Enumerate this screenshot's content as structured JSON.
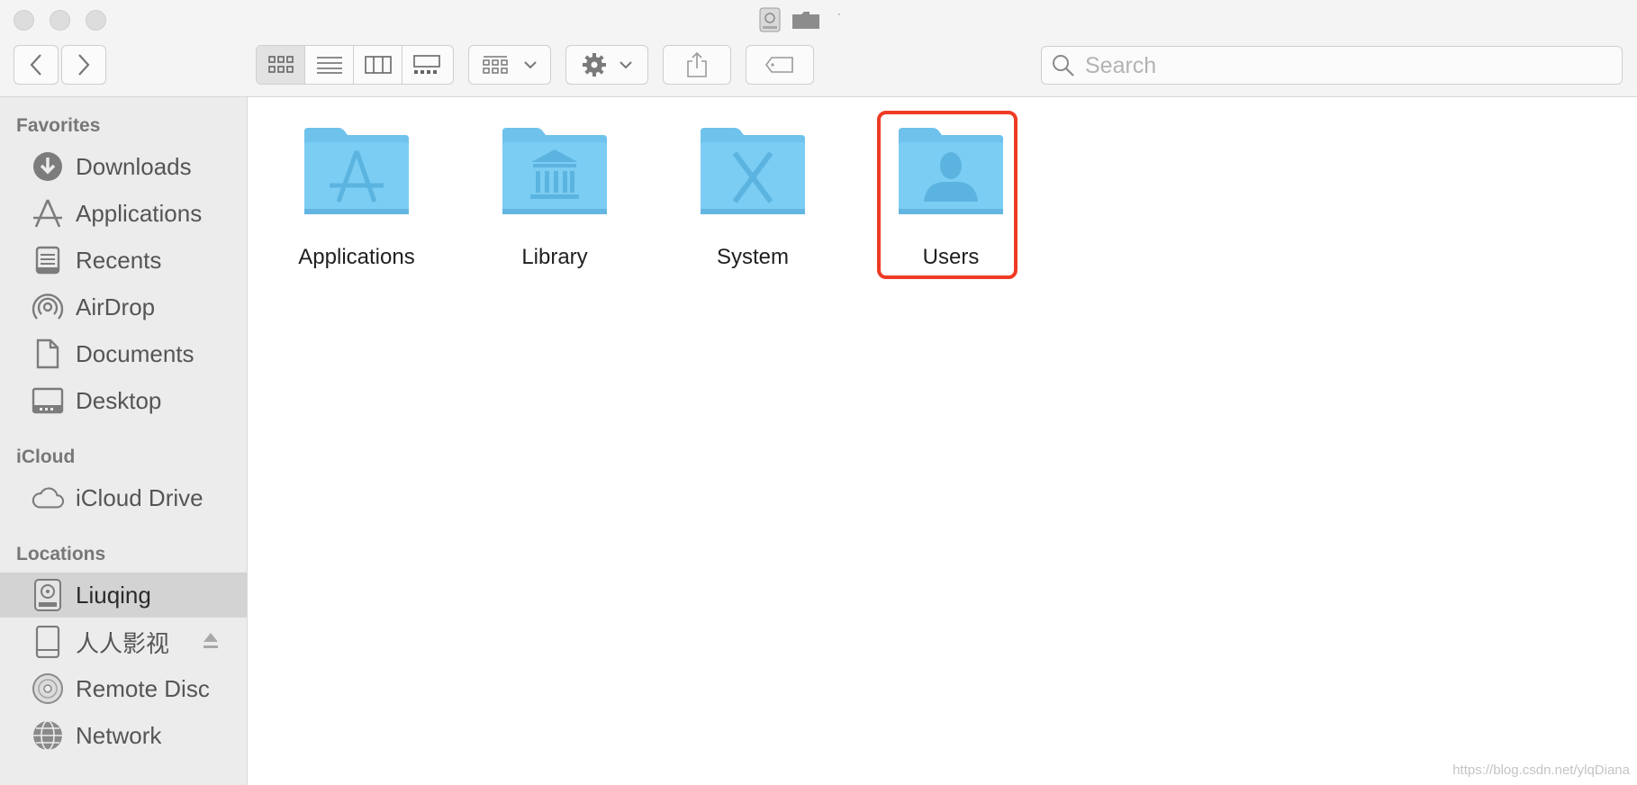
{
  "toolbar": {
    "back_icon": "chevron-left-icon",
    "forward_icon": "chevron-right-icon",
    "view_modes": [
      "icon-view-icon",
      "list-view-icon",
      "column-view-icon",
      "gallery-view-icon"
    ],
    "active_view": 0,
    "group_icon": "group-by-icon",
    "action_icon": "gear-icon",
    "share_icon": "share-icon",
    "tag_icon": "tag-icon",
    "search_placeholder": "Search"
  },
  "sidebar": {
    "favorites_heading": "Favorites",
    "favorites": [
      {
        "label": "Downloads",
        "icon": "downloads-icon"
      },
      {
        "label": "Applications",
        "icon": "applications-icon"
      },
      {
        "label": "Recents",
        "icon": "recents-icon"
      },
      {
        "label": "AirDrop",
        "icon": "airdrop-icon"
      },
      {
        "label": "Documents",
        "icon": "documents-icon"
      },
      {
        "label": "Desktop",
        "icon": "desktop-icon"
      }
    ],
    "icloud_heading": "iCloud",
    "icloud": [
      {
        "label": "iCloud Drive",
        "icon": "cloud-icon"
      }
    ],
    "locations_heading": "Locations",
    "locations": [
      {
        "label": "Liuqing",
        "icon": "hard-drive-icon",
        "selected": true
      },
      {
        "label": "人人影视",
        "icon": "external-drive-icon",
        "eject": true
      },
      {
        "label": "Remote Disc",
        "icon": "disc-icon"
      },
      {
        "label": "Network",
        "icon": "network-icon"
      }
    ]
  },
  "files": [
    {
      "name": "Applications",
      "icon": "applications-folder-icon"
    },
    {
      "name": "Library",
      "icon": "library-folder-icon"
    },
    {
      "name": "System",
      "icon": "system-folder-icon"
    },
    {
      "name": "Users",
      "icon": "users-folder-icon",
      "highlighted": true
    }
  ],
  "colors": {
    "folder_blue": "#7ccdf3",
    "folder_tab": "#6ec2ec",
    "highlight_red": "#ef3b24",
    "selection_gray": "#d3d3d3"
  },
  "watermark": "https://blog.csdn.net/ylqDiana"
}
